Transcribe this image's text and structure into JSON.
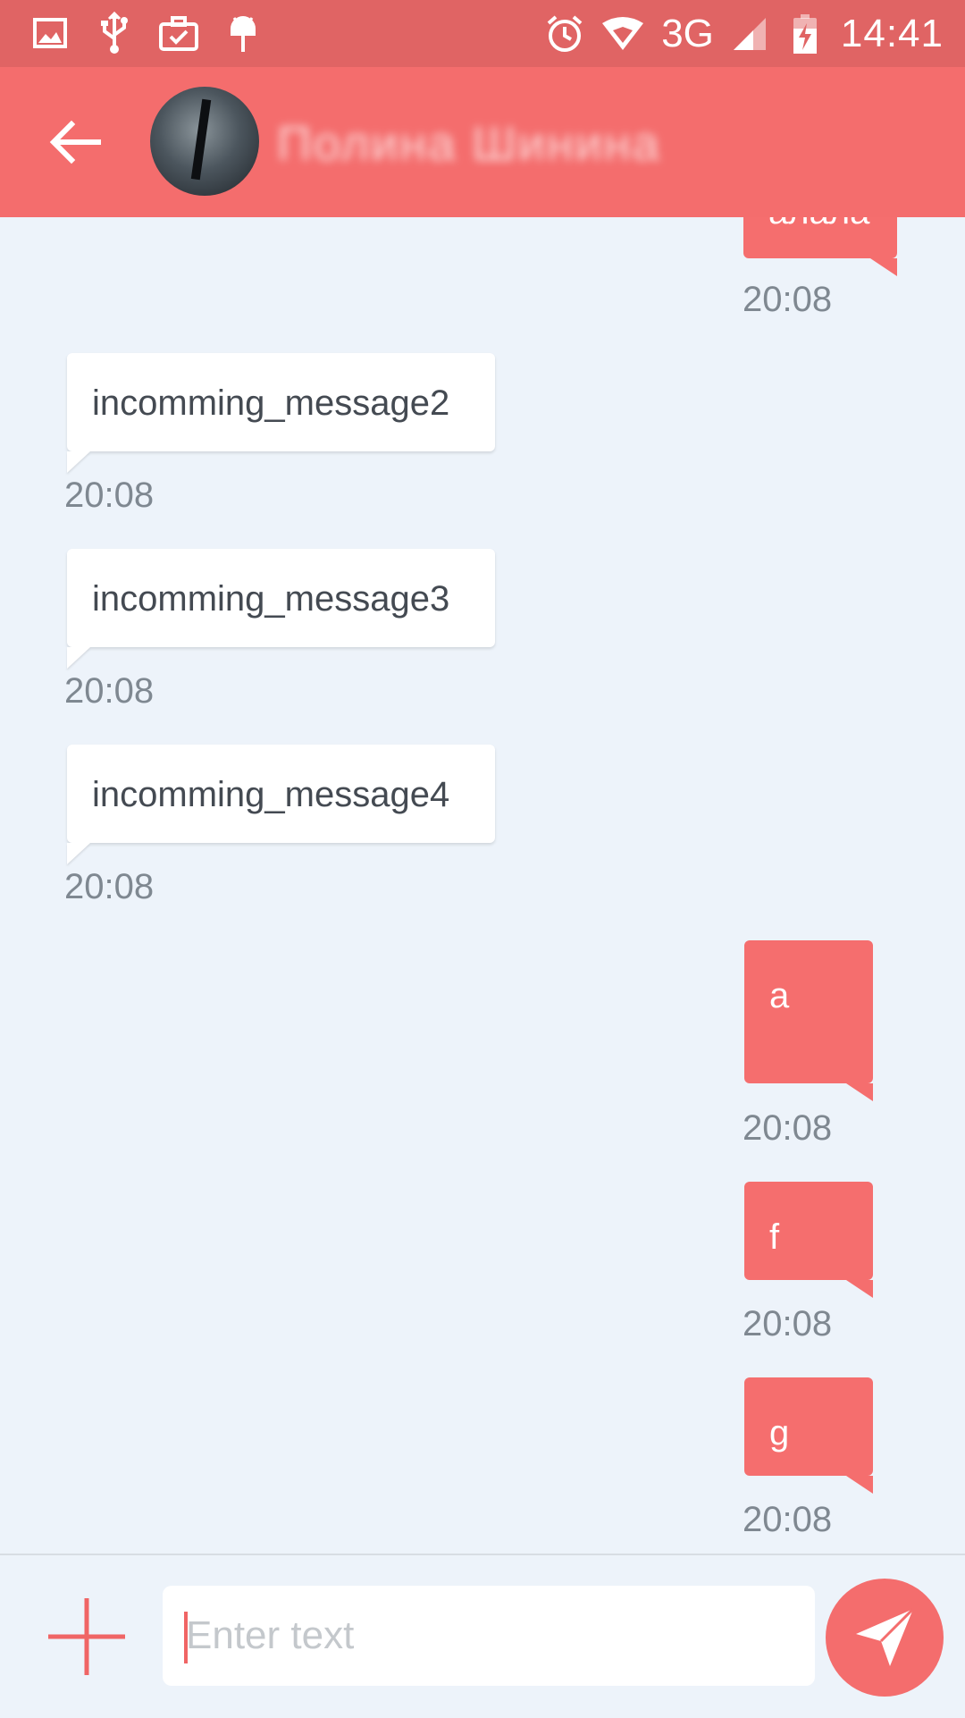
{
  "status_bar": {
    "time": "14:41",
    "network": "3G",
    "icons_left": [
      "gallery-icon",
      "usb-icon",
      "briefcase-check-icon",
      "android-debug-icon"
    ],
    "icons_right": [
      "alarm-icon",
      "wifi-icon",
      "signal-icon",
      "battery-charging-icon"
    ]
  },
  "app_bar": {
    "contact_name": "Полина Шинина",
    "back_icon": "arrow-back-icon"
  },
  "messages": [
    {
      "direction": "out",
      "text": "алала",
      "time": "20:08"
    },
    {
      "direction": "in",
      "text": "incomming_message2",
      "time": "20:08"
    },
    {
      "direction": "in",
      "text": "incomming_message3",
      "time": "20:08"
    },
    {
      "direction": "in",
      "text": "incomming_message4",
      "time": "20:08"
    },
    {
      "direction": "out",
      "text": "a",
      "time": "20:08"
    },
    {
      "direction": "out",
      "text": "f",
      "time": "20:08"
    },
    {
      "direction": "out",
      "text": "g",
      "time": "20:08"
    }
  ],
  "input": {
    "placeholder": "Enter text",
    "value": ""
  },
  "colors": {
    "status_bar": "#e06464",
    "app_bar": "#f46d6d",
    "outgoing_bubble": "#f56e6e",
    "incoming_bubble": "#ffffff",
    "background": "#edf3fa",
    "timestamp": "#7f8891"
  }
}
